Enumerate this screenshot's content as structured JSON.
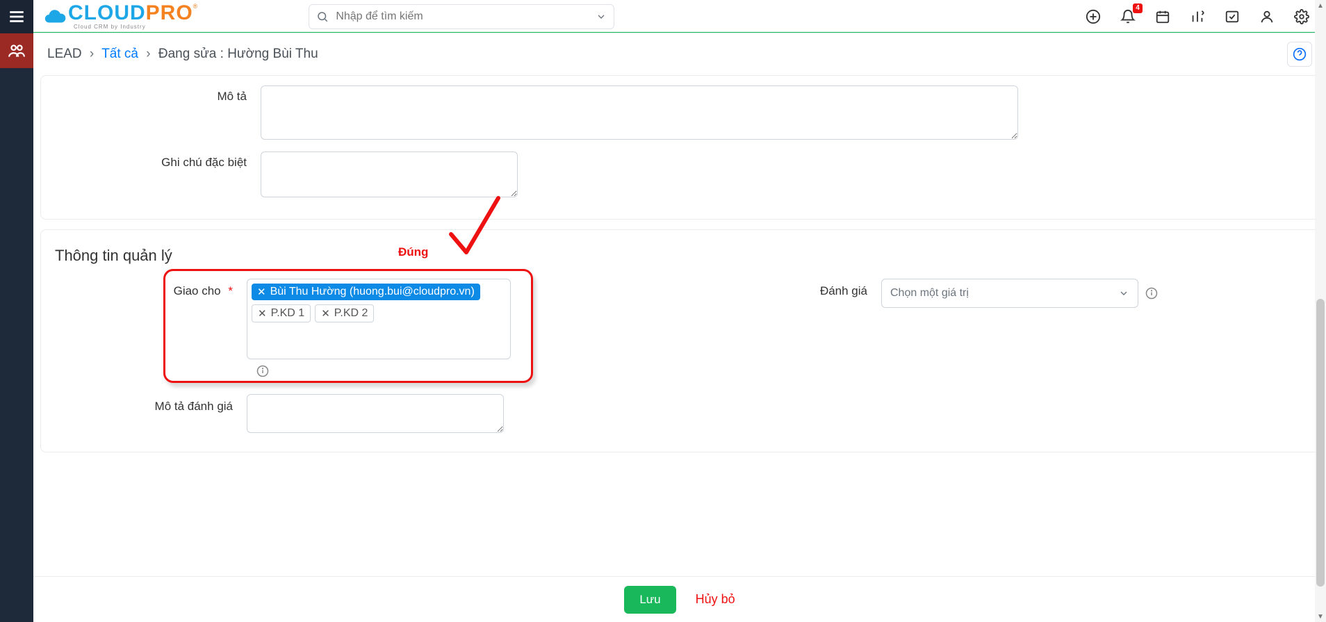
{
  "header": {
    "logo_main": "CLOUD",
    "logo_accent": "PRO",
    "logo_tagline": "Cloud CRM by Industry",
    "search_placeholder": "Nhập để tìm kiếm",
    "notification_count": "4"
  },
  "breadcrumb": {
    "module": "LEAD",
    "filter": "Tất cả",
    "current": "Đang sửa : Hường Bùi Thu"
  },
  "fields": {
    "description_label": "Mô tả",
    "special_note_label": "Ghi chú đặc biệt",
    "section_title": "Thông tin quản lý",
    "assigned_label": "Giao cho",
    "rating_label": "Đánh giá",
    "rating_placeholder": "Chọn một giá trị",
    "rating_desc_label": "Mô tả đánh giá"
  },
  "assigned_tags": {
    "user": "Bùi Thu Hường (huong.bui@cloudpro.vn)",
    "dept1": "P.KD 1",
    "dept2": "P.KD 2"
  },
  "annotation": {
    "correct_label": "Đúng"
  },
  "footer": {
    "save": "Lưu",
    "cancel": "Hủy bỏ"
  }
}
